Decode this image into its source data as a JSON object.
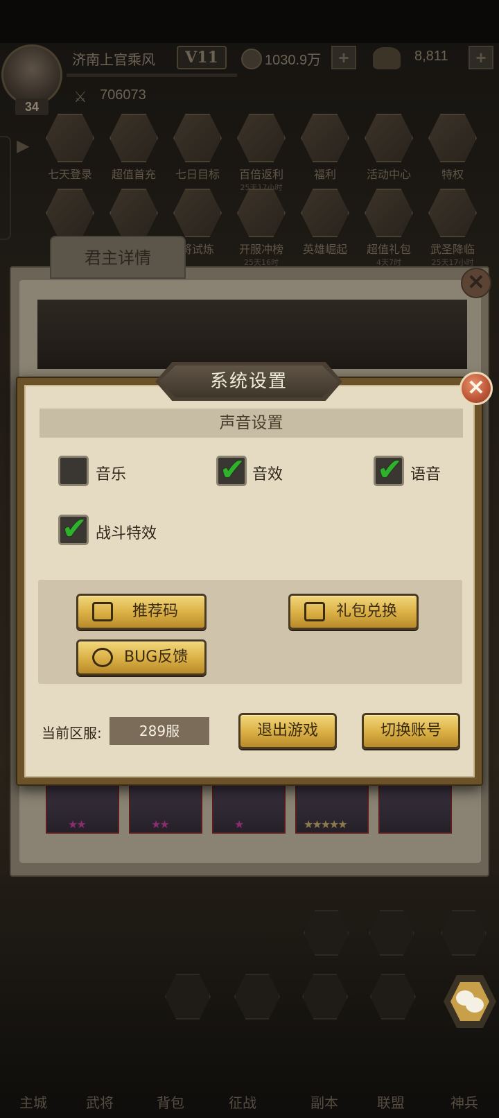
{
  "hud": {
    "player_name": "济南上官乘风",
    "vip": "V11",
    "level": "34",
    "power": "706073",
    "gold": "1030.9万",
    "ingot": "8,811",
    "plus": "+"
  },
  "activities_row1": [
    {
      "label": "七天登录",
      "sub": ""
    },
    {
      "label": "超值首充",
      "sub": ""
    },
    {
      "label": "七日目标",
      "sub": ""
    },
    {
      "label": "百倍返利",
      "sub": "25天17小时"
    },
    {
      "label": "福利",
      "sub": ""
    },
    {
      "label": "活动中心",
      "sub": ""
    },
    {
      "label": "特权",
      "sub": ""
    }
  ],
  "activities_row2": [
    {
      "label": "",
      "sub": ""
    },
    {
      "label": "",
      "sub": ""
    },
    {
      "label": "将试炼",
      "sub": ""
    },
    {
      "label": "开服冲榜",
      "sub": "25天16时"
    },
    {
      "label": "英雄崛起",
      "sub": ""
    },
    {
      "label": "超值礼包",
      "sub": "4天7时"
    },
    {
      "label": "武圣降临",
      "sub": "25天17小时"
    }
  ],
  "lord_panel": {
    "tab_title": "君主详情",
    "close": "✕"
  },
  "heroes": [
    {
      "stars": "★★",
      "gold": false
    },
    {
      "stars": "★★",
      "gold": false
    },
    {
      "stars": "★",
      "gold": false
    },
    {
      "stars": "★★★★★",
      "gold": true
    },
    {
      "stars": "",
      "gold": true
    }
  ],
  "bottom_nav": [
    "主城",
    "武将",
    "背包",
    "征战",
    "副本",
    "联盟",
    "神兵"
  ],
  "settings": {
    "title": "系统设置",
    "close": "✕",
    "sound_header": "声音设置",
    "options": [
      {
        "label": "音乐",
        "checked": false
      },
      {
        "label": "音效",
        "checked": true
      },
      {
        "label": "语音",
        "checked": true
      },
      {
        "label": "战斗特效",
        "checked": true
      }
    ],
    "tick": "✔",
    "buttons": {
      "referral": "推荐码",
      "gift_redeem": "礼包兑换",
      "bug_feedback": "BUG反馈",
      "exit_game": "退出游戏",
      "switch_account": "切换账号"
    },
    "server_label": "当前区服:",
    "server_value": "289服"
  },
  "colors": {
    "checkbox_tick": "#2fb22b",
    "button_gold": "#d9af44",
    "close_red": "#c0593a",
    "panel_parchment": "#e5dbc3"
  }
}
